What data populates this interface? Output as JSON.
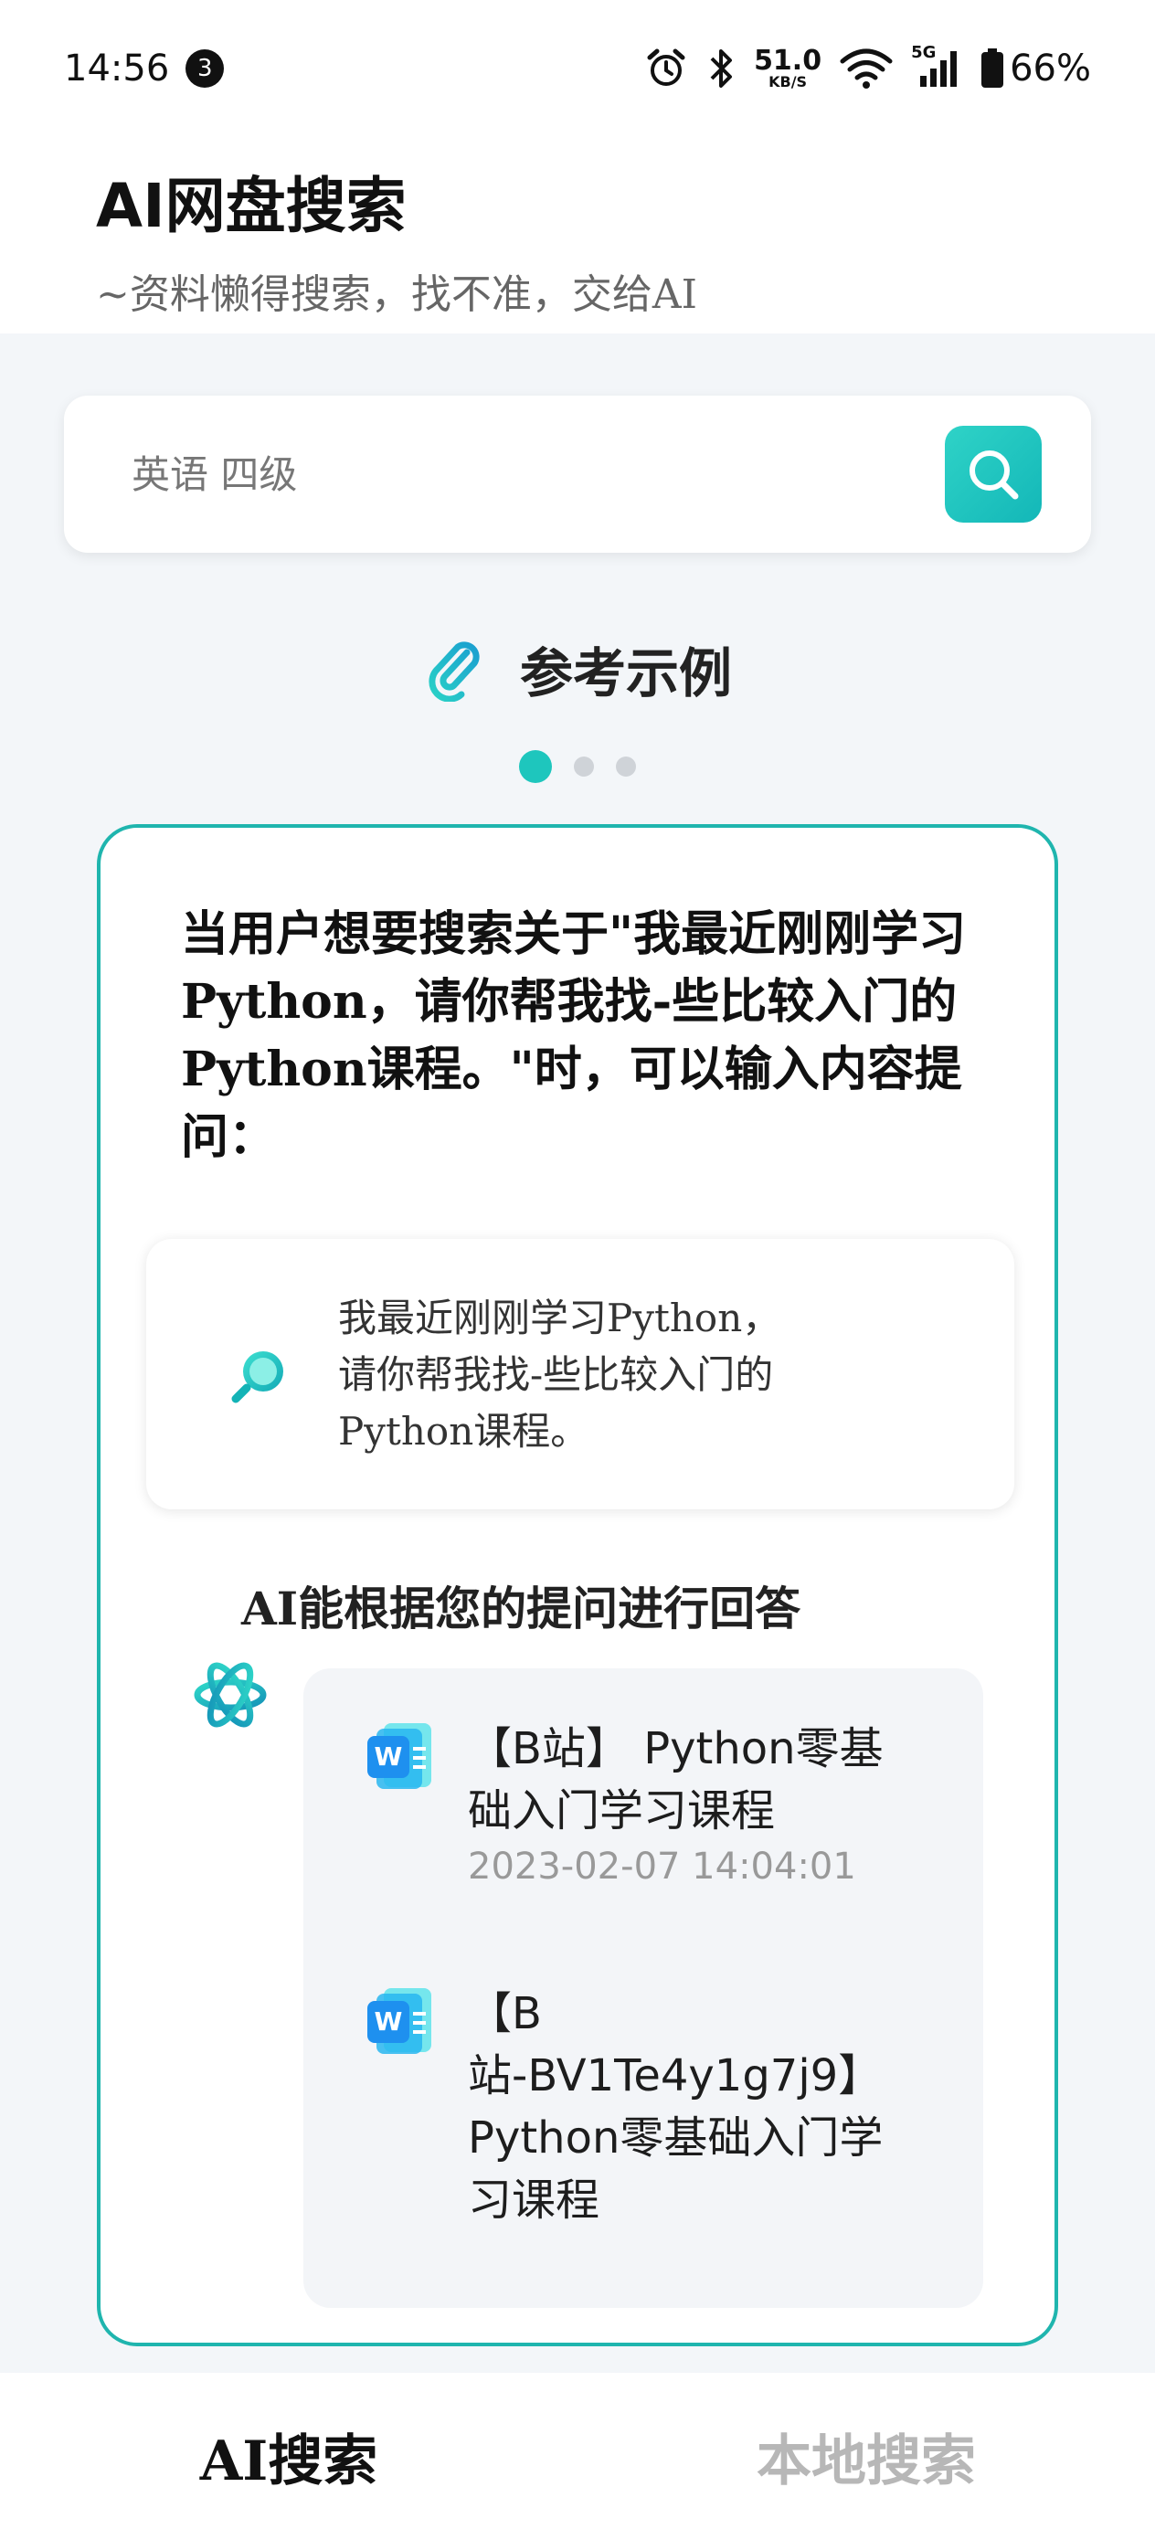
{
  "status_bar": {
    "time": "14:56",
    "notification_count": "3",
    "net_speed_value": "51.0",
    "net_speed_unit": "KB/S",
    "network_type": "5G",
    "battery": "66%"
  },
  "header": {
    "title": "AI网盘搜索",
    "subtitle": "~资料懒得搜索，找不准，交给AI"
  },
  "search": {
    "value": "",
    "placeholder": "英语 四级"
  },
  "examples": {
    "title": "参考示例",
    "page_count": 3,
    "active_page": 1,
    "question": "当用户想要搜索关于\"我最近刚刚学习Python，请你帮我找-些比较入门的Python课程。\"时，可以输入内容提问：",
    "prompt_line1": "我最近刚刚学习Python，",
    "prompt_line2": "请你帮我找-些比较入门的",
    "prompt_line3": "Python课程。",
    "answer_caption": "AI能根据您的提问进行回答",
    "results": [
      {
        "title_line1": "【B站】 Python零基",
        "title_line2": "础入门学习课程",
        "date": "2023-02-07 14:04:01",
        "icon": "word-document-icon"
      },
      {
        "title_line1": "【B",
        "title_line2": "站-BV1Te4y1g7j9】",
        "title_line3": "Python零基础入门学",
        "title_line4": "习课程",
        "icon": "word-document-icon"
      }
    ]
  },
  "bottom_nav": {
    "tabs": [
      {
        "label": "AI搜索",
        "active": true
      },
      {
        "label": "本地搜索",
        "active": false
      }
    ]
  },
  "colors": {
    "accent": "#1ec6bd",
    "card_border": "#1fb5ae",
    "background": "#f3f6f9"
  }
}
